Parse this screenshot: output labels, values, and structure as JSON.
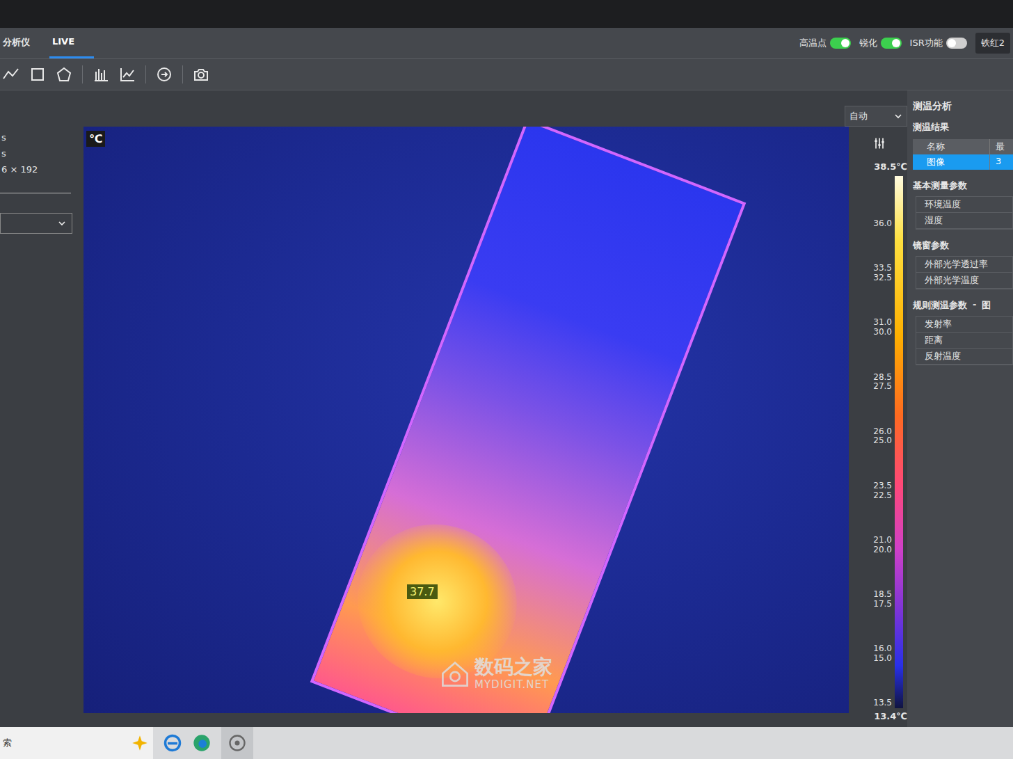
{
  "tabs": [
    {
      "label": "分析仪",
      "selected": false
    },
    {
      "label": "LIVE",
      "selected": true
    }
  ],
  "toggles": [
    {
      "label": "高温点",
      "on": true
    },
    {
      "label": "锐化",
      "on": true
    },
    {
      "label": "ISR功能",
      "on": false
    }
  ],
  "palette": {
    "value": "铁红2"
  },
  "left_panel": {
    "lines": [
      "s",
      "s",
      "6 × 192"
    ]
  },
  "image": {
    "unit": "℃",
    "hotspot": "37.7"
  },
  "watermark": {
    "name": "数码之家",
    "url": "MYDIGIT.NET"
  },
  "scale": {
    "mode": "自动",
    "max": "38.5℃",
    "min": "13.4℃",
    "ticks": [
      {
        "labels": [
          "36.0"
        ]
      },
      {
        "labels": [
          "33.5",
          "32.5"
        ]
      },
      {
        "labels": [
          "31.0",
          "30.0"
        ]
      },
      {
        "labels": [
          "28.5",
          "27.5"
        ]
      },
      {
        "labels": [
          "26.0",
          "25.0"
        ]
      },
      {
        "labels": [
          "23.5",
          "22.5"
        ]
      },
      {
        "labels": [
          "21.0",
          "20.0"
        ]
      },
      {
        "labels": [
          "18.5",
          "17.5"
        ]
      },
      {
        "labels": [
          "16.0",
          "15.0"
        ]
      },
      {
        "labels": [
          "13.5"
        ]
      }
    ]
  },
  "right_panel": {
    "title": "测温分析",
    "results": {
      "title": "测温结果",
      "columns": [
        "名称",
        "最"
      ],
      "rows": [
        {
          "cells": [
            "图像",
            "3"
          ],
          "selected": true
        }
      ]
    },
    "sections": [
      {
        "title": "基本测量参数",
        "separator": "",
        "suffix": "",
        "fields": [
          "环境温度",
          "湿度"
        ]
      },
      {
        "title": "镜窗参数",
        "separator": "",
        "suffix": "",
        "fields": [
          "外部光学透过率",
          "外部光学温度"
        ]
      },
      {
        "title": "规则测温参数",
        "separator": "-",
        "suffix": "图",
        "fields": [
          "发射率",
          "距离",
          "反射温度"
        ]
      }
    ]
  },
  "taskbar": {
    "search": "索"
  }
}
